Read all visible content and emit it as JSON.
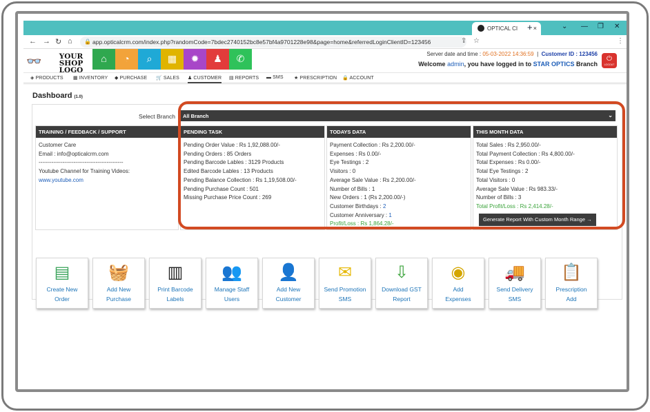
{
  "browser": {
    "tab_title": "OPTICAL CI",
    "url": "app.opticalcrm.com/index.php?randomCode=7bdec2740152bc8e57bf4a9701228e98&page=home&referredLoginClientID=123456"
  },
  "header": {
    "logo_line1": "YOUR",
    "logo_line2": "SHOP LOGO",
    "server_label": "Server date and time :",
    "server_datetime": "05-03-2022 14:36:59",
    "customer_id_label": "Customer ID :",
    "customer_id": "123456",
    "welcome_prefix": "Welcome",
    "welcome_user": "admin",
    "welcome_mid": ", you have logged in to",
    "welcome_branch": "STAR OPTICS",
    "welcome_suffix": "Branch",
    "logout_label": "LOGOUT",
    "quick_buttons": [
      {
        "name": "home-icon",
        "color": "#2fa84f",
        "glyph": "⌂"
      },
      {
        "name": "dashboard-icon",
        "color": "#f2a33a",
        "glyph": "◔"
      },
      {
        "name": "search-icon",
        "color": "#1fa9d6",
        "glyph": "⌕"
      },
      {
        "name": "grid-icon",
        "color": "#e0b400",
        "glyph": "▦"
      },
      {
        "name": "gear-icon",
        "color": "#a846c8",
        "glyph": "✹"
      },
      {
        "name": "user-icon",
        "color": "#e23b3b",
        "glyph": "♟"
      },
      {
        "name": "whatsapp-icon",
        "color": "#2fc25a",
        "glyph": "✆"
      }
    ]
  },
  "menu": [
    {
      "label": "PRODUCTS",
      "icon": "box-icon"
    },
    {
      "label": "INVENTORY",
      "icon": "grid-icon"
    },
    {
      "label": "PURCHASE",
      "icon": "tag-icon"
    },
    {
      "label": "SALES",
      "icon": "cart-icon"
    },
    {
      "label": "CUSTOMER",
      "icon": "user-icon",
      "active": true
    },
    {
      "label": "REPORTS",
      "icon": "file-icon"
    },
    {
      "label": "SMS",
      "icon": "comment-icon"
    },
    {
      "label": "PRESCRIPTION",
      "icon": "star-icon"
    },
    {
      "label": "ACCOUNT",
      "icon": "lock-icon"
    }
  ],
  "dashboard": {
    "title": "Dashboard",
    "version": "(1.0)",
    "select_branch_label": "Select Branch",
    "select_branch_value": "All Branch"
  },
  "training": {
    "heading": "TRAINING / FEEDBACK / SUPPORT",
    "lines": [
      "Customer Care",
      "Email : info@opticalcrm.com",
      "----------------------------------------------",
      "Youtube Channel for Training Videos:"
    ],
    "link": "www.youtube.com"
  },
  "pending": {
    "heading": "PENDING TASK",
    "lines": [
      "Pending Order Value : Rs 1,92,088.00/-",
      "Pending Orders : 85 Orders",
      "Pending Barcode Lables : 3129 Products",
      "Edited Barcode Lables : 13 Products",
      "Pending Balance Collection : Rs 1,19,508.00/-",
      "Pending Purchase Count : 501",
      "Missing Purchase Price Count : 269"
    ]
  },
  "today": {
    "heading": "TODAYS DATA",
    "lines": [
      "Payment Collection : Rs 2,200.00/-",
      "Expenses : Rs 0.00/-",
      "Eye Testings : 2",
      "Visitors : 0",
      "Average Sale Value : Rs 2,200.00/-",
      "Number of Bills : 1",
      "New Orders : 1 (Rs 2,200.00/-)"
    ],
    "birthdays_label": "Customer Birthdays :",
    "birthdays_value": "2",
    "anniversary_label": "Customer Anniversary :",
    "anniversary_value": "1",
    "profit": "Profit/Loss : Rs 1,864.28/-"
  },
  "month": {
    "heading": "THIS MONTH DATA",
    "lines": [
      "Total Sales : Rs 2,950.00/-",
      "Total Payment Collection : Rs 4,800.00/-",
      "Total Expenses : Rs 0.00/-",
      "Total Eye Testings : 2",
      "Total Visitors : 0",
      "Average Sale Value : Rs 983.33/-",
      "Number of Bills : 3"
    ],
    "profit": "Total Profit/Loss : Rs 2,414.28/-",
    "report_button": "Generate Report With Custom Month Range"
  },
  "tiles": [
    {
      "l1": "Create New",
      "l2": "Order",
      "icon": "create-order-icon",
      "glyph": "▤",
      "color": "#3aa35a"
    },
    {
      "l1": "Add New",
      "l2": "Purchase",
      "icon": "basket-icon",
      "glyph": "🧺",
      "color": "#c0392b"
    },
    {
      "l1": "Print Barcode",
      "l2": "Labels",
      "icon": "barcode-icon",
      "glyph": "▥",
      "color": "#222"
    },
    {
      "l1": "Manage Staff",
      "l2": "Users",
      "icon": "staff-icon",
      "glyph": "👥",
      "color": "#555"
    },
    {
      "l1": "Add New",
      "l2": "Customer",
      "icon": "add-customer-icon",
      "glyph": "👤",
      "color": "#333"
    },
    {
      "l1": "Send Promotion",
      "l2": "SMS",
      "icon": "envelope-icon",
      "glyph": "✉",
      "color": "#e5b700"
    },
    {
      "l1": "Download GST",
      "l2": "Report",
      "icon": "download-icon",
      "glyph": "⇩",
      "color": "#3aa33a"
    },
    {
      "l1": "Add",
      "l2": "Expenses",
      "icon": "coins-icon",
      "glyph": "◉",
      "color": "#d4a600"
    },
    {
      "l1": "Send Delivery",
      "l2": "SMS",
      "icon": "truck-icon",
      "glyph": "🚚",
      "color": "#2d6fb3"
    },
    {
      "l1": "Prescription",
      "l2": "Add",
      "icon": "clipboard-icon",
      "glyph": "📋",
      "color": "#c0392b"
    }
  ]
}
